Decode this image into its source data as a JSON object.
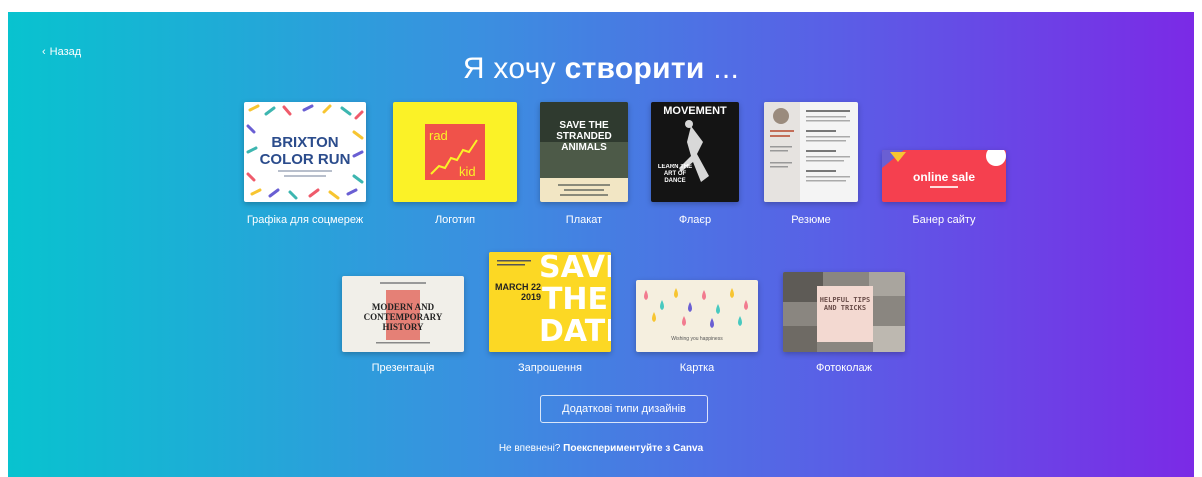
{
  "nav": {
    "back_label": "Назад"
  },
  "title": {
    "prefix": "Я хочу",
    "bold": "створити",
    "suffix": "..."
  },
  "designs": [
    {
      "label": "Графіка для соцмереж"
    },
    {
      "label": "Логотип"
    },
    {
      "label": "Плакат"
    },
    {
      "label": "Флаєр"
    },
    {
      "label": "Резюме"
    },
    {
      "label": "Банер сайту"
    },
    {
      "label": "Презентація"
    },
    {
      "label": "Запрошення"
    },
    {
      "label": "Картка"
    },
    {
      "label": "Фотоколаж"
    }
  ],
  "thumbs": {
    "social": {
      "line1": "BRIXTON",
      "line2": "COLOR RUN"
    },
    "logo": {
      "top": "rad",
      "bottom": "kid"
    },
    "poster": {
      "text": "SAVE THE STRANDED ANIMALS"
    },
    "flyer": {
      "head": "MOVEMENT",
      "sub": "LEARN THE ART OF DANCE"
    },
    "banner": {
      "text": "online sale"
    },
    "presentation": {
      "text": "MODERN AND CONTEMPORARY HISTORY"
    },
    "invitation": {
      "big": "SAVE THE DATE",
      "date": "MARCH 22 2019"
    },
    "card": {
      "text": "Wishing you happiness"
    },
    "collage": {
      "text": "HELPFUL TIPS AND TRICKS"
    }
  },
  "more_button": {
    "label": "Додаткові типи дизайнів"
  },
  "footer": {
    "question": "Не впевнені?",
    "link": "Поекспериментуйте з Canva"
  },
  "colors": {
    "gradient_start": "#08c3cf",
    "gradient_end": "#7b2ae6"
  }
}
